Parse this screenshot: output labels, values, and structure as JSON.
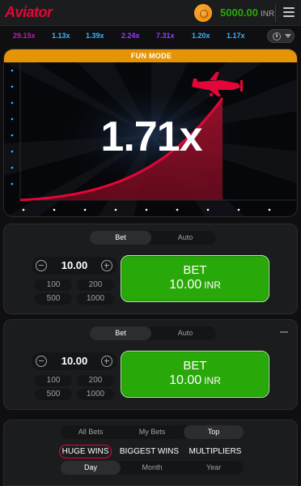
{
  "header": {
    "logo": "Aviator",
    "balance": "5000.00",
    "currency": "INR"
  },
  "history": [
    "29.15x",
    "1.13x",
    "1.39x",
    "2.24x",
    "7.31x",
    "1.20x",
    "1.17x"
  ],
  "history_colors": [
    "#c017b4",
    "#34b4ff",
    "#34b4ff",
    "#913ef8",
    "#913ef8",
    "#34b4ff",
    "#34b4ff"
  ],
  "game": {
    "mode_label": "FUN MODE",
    "multiplier": "1.71x",
    "accent_color": "#e50539",
    "bar_color": "#e59407"
  },
  "bet_panels": [
    {
      "tabs": [
        "Bet",
        "Auto"
      ],
      "active_tab": "Bet",
      "amount": "10.00",
      "quick_amounts": [
        "100",
        "200",
        "500",
        "1000"
      ],
      "button_label": "BET",
      "button_amount": "10.00",
      "button_currency": "INR"
    },
    {
      "tabs": [
        "Bet",
        "Auto"
      ],
      "active_tab": "Bet",
      "amount": "10.00",
      "quick_amounts": [
        "100",
        "200",
        "500",
        "1000"
      ],
      "button_label": "BET",
      "button_amount": "10.00",
      "button_currency": "INR"
    }
  ],
  "bets_panel": {
    "tabs": [
      "All Bets",
      "My Bets",
      "Top"
    ],
    "active_tab": "Top",
    "categories": [
      "HUGE WINS",
      "BIGGEST WINS",
      "MULTIPLIERS"
    ],
    "active_category": "HUGE WINS",
    "periods": [
      "Day",
      "Month",
      "Year"
    ],
    "active_period": "Day"
  }
}
